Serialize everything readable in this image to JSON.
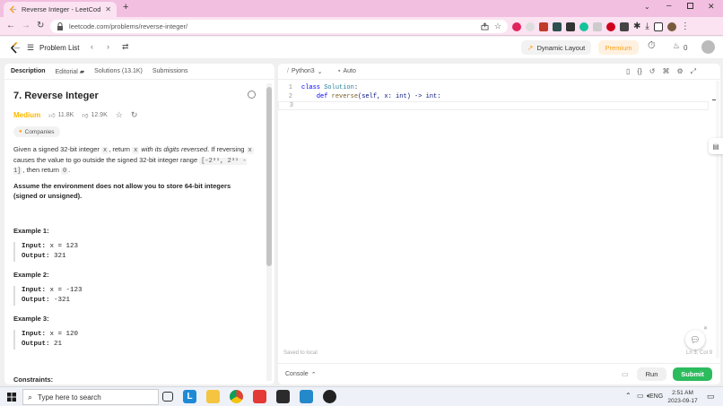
{
  "browser": {
    "tab_title": "Reverse Integer - LeetCode",
    "url": "leetcode.com/problems/reverse-integer/"
  },
  "header": {
    "problem_list": "Problem List",
    "dynamic_layout": "Dynamic Layout",
    "premium": "Premium",
    "streak_count": "0"
  },
  "left_tabs": {
    "description": "Description",
    "editorial": "Editorial",
    "solutions": "Solutions (13.1K)",
    "submissions": "Submissions"
  },
  "problem": {
    "title": "7. Reverse Integer",
    "difficulty": "Medium",
    "likes": "11.8K",
    "dislikes": "12.9K",
    "companies": "Companies",
    "desc_p1": "Given a signed 32-bit integer",
    "code_x": "x",
    "desc_p2": ", return",
    "desc_p3": "with its digits reversed",
    "desc_p4": ". If reversing",
    "desc_p5": "causes the value to go outside the signed 32-bit integer range",
    "range": "[-2³¹, 2³¹ - 1]",
    "desc_p6": ",",
    "desc_p7": "then return",
    "code_zero": "0",
    "desc_p8": ".",
    "note": "Assume the environment does not allow you to store 64-bit integers (signed or unsigned).",
    "examples": [
      {
        "title": "Example 1:",
        "input_label": "Input:",
        "input": "x = 123",
        "output_label": "Output:",
        "output": "321"
      },
      {
        "title": "Example 2:",
        "input_label": "Input:",
        "input": "x = -123",
        "output_label": "Output:",
        "output": "-321"
      },
      {
        "title": "Example 3:",
        "input_label": "Input:",
        "input": "x = 120",
        "output_label": "Output:",
        "output": "21"
      }
    ],
    "constraints": "Constraints:"
  },
  "editor": {
    "language": "Python3",
    "mode": "Auto",
    "lines": [
      {
        "num": "1",
        "text": ""
      },
      {
        "num": "2",
        "text": ""
      },
      {
        "num": "3",
        "text": ""
      }
    ],
    "line1_kw": "class",
    "line1_cls": "Solution",
    "line1_rest": ":",
    "line2_kw": "def",
    "line2_fn": "reverse",
    "line2_rest": "(self, x: int) -> int:",
    "saved": "Saved to local",
    "cursor_pos": "Ln 3, Col 9"
  },
  "bottom": {
    "console": "Console",
    "run": "Run",
    "submit": "Submit"
  },
  "taskbar": {
    "search_placeholder": "Type here to search",
    "lang": "ENG",
    "time": "2:51 AM",
    "date": "2023-09-17"
  },
  "colors": {
    "medium": "#ffb800",
    "premium": "#ffa116",
    "submit": "#2cbb5d",
    "brand": "#ffa116"
  }
}
